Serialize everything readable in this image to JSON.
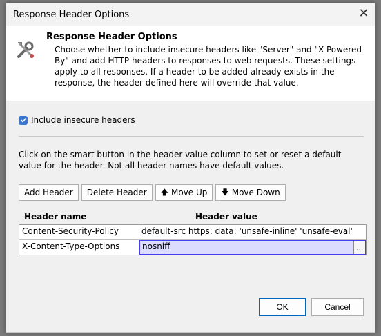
{
  "window": {
    "title": "Response Header Options"
  },
  "header_panel": {
    "title": "Response Header Options",
    "description": "Choose whether to include insecure headers like \"Server\" and \"X-Powered-By\" and add HTTP headers to responses to web requests. These settings apply to all responses. If a header to be added already exists in the response, the header defined here will override that value.",
    "icon": "tools-icon"
  },
  "include_insecure": {
    "label": "Include insecure headers",
    "checked": true
  },
  "instructions": "Click on the smart button in the header value column to set or reset a default value for the header. Not all header names have default values.",
  "toolbar": {
    "add_label": "Add Header",
    "delete_label": "Delete Header",
    "move_up_label": "Move Up",
    "move_down_label": "Move Down"
  },
  "grid": {
    "columns": [
      "Header name",
      "Header value"
    ],
    "rows": [
      {
        "name": "Content-Security-Policy",
        "value": "default-src https: data: 'unsafe-inline' 'unsafe-eval'"
      },
      {
        "name": "X-Content-Type-Options",
        "value": "nosniff"
      }
    ],
    "smart_button": "..."
  },
  "buttons": {
    "ok": "OK",
    "cancel": "Cancel"
  },
  "colors": {
    "accent": "#3a77d1",
    "edit_bg": "#dcdcff",
    "edit_border": "#3f3ff0"
  }
}
